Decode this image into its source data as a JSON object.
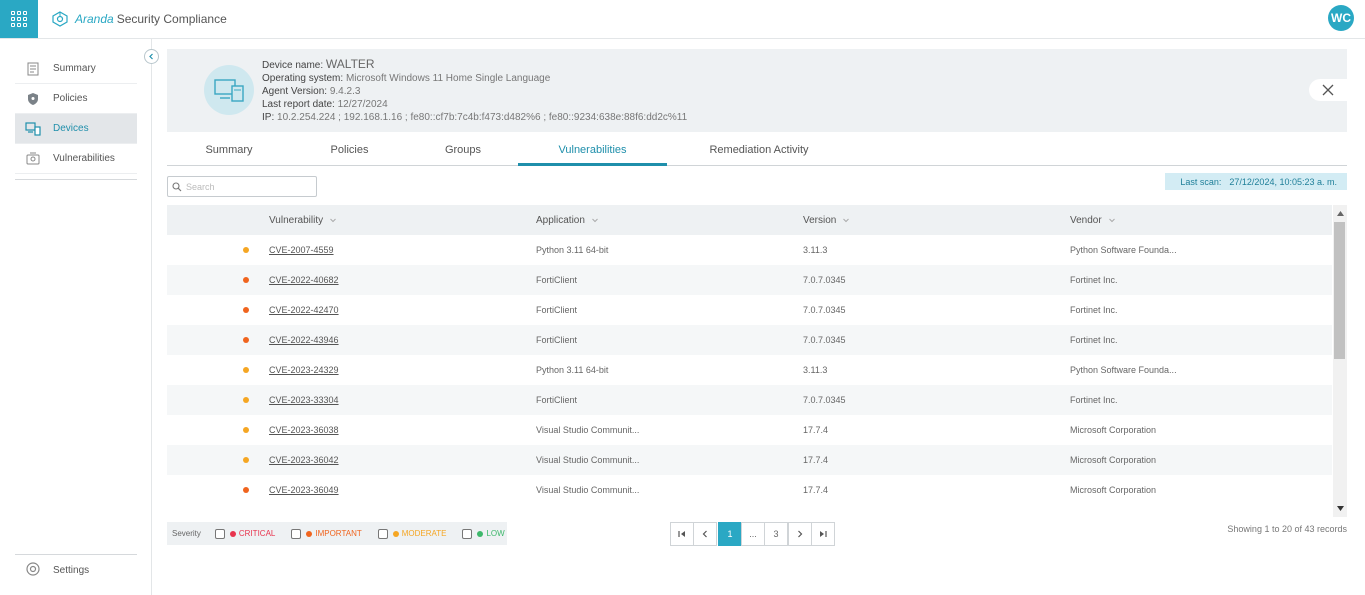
{
  "app": {
    "brand_aranda": "Aranda",
    "brand_product": "Security Compliance",
    "avatar_initials": "WC",
    "accent_color": "#2aa8c4"
  },
  "sidebar": {
    "items": [
      {
        "label": "Summary",
        "icon": "summary-icon"
      },
      {
        "label": "Policies",
        "icon": "shield-icon"
      },
      {
        "label": "Devices",
        "icon": "devices-icon",
        "active": true
      },
      {
        "label": "Vulnerabilities",
        "icon": "vulnerability-icon"
      }
    ],
    "settings_label": "Settings"
  },
  "device": {
    "name_label": "Device name:",
    "name": "WALTER",
    "os_label": "Operating system:",
    "os": "Microsoft Windows 11 Home Single Language",
    "agent_label": "Agent Version:",
    "agent": "9.4.2.3",
    "report_label": "Last report date:",
    "report": "12/27/2024",
    "ip_label": "IP:",
    "ip": "10.2.254.224 ; 192.168.1.16 ; fe80::cf7b:7c4b:f473:d482%6 ; fe80::9234:638e:88f6:dd2c%11"
  },
  "tabs": [
    {
      "label": "Summary"
    },
    {
      "label": "Policies"
    },
    {
      "label": "Groups"
    },
    {
      "label": "Vulnerabilities",
      "active": true
    },
    {
      "label": "Remediation Activity"
    }
  ],
  "search": {
    "placeholder": "Search"
  },
  "last_scan": {
    "label": "Last scan:",
    "value": "27/12/2024, 10:05:23 a. m."
  },
  "table": {
    "headers": {
      "vulnerability": "Vulnerability",
      "application": "Application",
      "version": "Version",
      "vendor": "Vendor"
    },
    "rows": [
      {
        "severity": "moderate",
        "cve": "CVE-2007-4559",
        "application": "Python 3.11 64-bit",
        "version": "3.11.3",
        "vendor": "Python Software Founda..."
      },
      {
        "severity": "important",
        "cve": "CVE-2022-40682",
        "application": "FortiClient",
        "version": "7.0.7.0345",
        "vendor": "Fortinet Inc."
      },
      {
        "severity": "important",
        "cve": "CVE-2022-42470",
        "application": "FortiClient",
        "version": "7.0.7.0345",
        "vendor": "Fortinet Inc."
      },
      {
        "severity": "important",
        "cve": "CVE-2022-43946",
        "application": "FortiClient",
        "version": "7.0.7.0345",
        "vendor": "Fortinet Inc."
      },
      {
        "severity": "moderate",
        "cve": "CVE-2023-24329",
        "application": "Python 3.11 64-bit",
        "version": "3.11.3",
        "vendor": "Python Software Founda..."
      },
      {
        "severity": "moderate",
        "cve": "CVE-2023-33304",
        "application": "FortiClient",
        "version": "7.0.7.0345",
        "vendor": "Fortinet Inc."
      },
      {
        "severity": "moderate",
        "cve": "CVE-2023-36038",
        "application": "Visual Studio Communit...",
        "version": "17.7.4",
        "vendor": "Microsoft Corporation"
      },
      {
        "severity": "moderate",
        "cve": "CVE-2023-36042",
        "application": "Visual Studio Communit...",
        "version": "17.7.4",
        "vendor": "Microsoft Corporation"
      },
      {
        "severity": "important",
        "cve": "CVE-2023-36049",
        "application": "Visual Studio Communit...",
        "version": "17.7.4",
        "vendor": "Microsoft Corporation"
      }
    ]
  },
  "severity_legend": {
    "title": "Severity",
    "levels": [
      {
        "key": "critical",
        "label": "CRITICAL",
        "color": "#e8344e"
      },
      {
        "key": "important",
        "label": "IMPORTANT",
        "color": "#f0641e"
      },
      {
        "key": "moderate",
        "label": "MODERATE",
        "color": "#f5a623"
      },
      {
        "key": "low",
        "label": "LOW",
        "color": "#3db86b"
      }
    ]
  },
  "pagination": {
    "pages": [
      "1",
      "...",
      "3"
    ],
    "current": "1",
    "records_text": "Showing 1 to 20 of 43 records"
  }
}
